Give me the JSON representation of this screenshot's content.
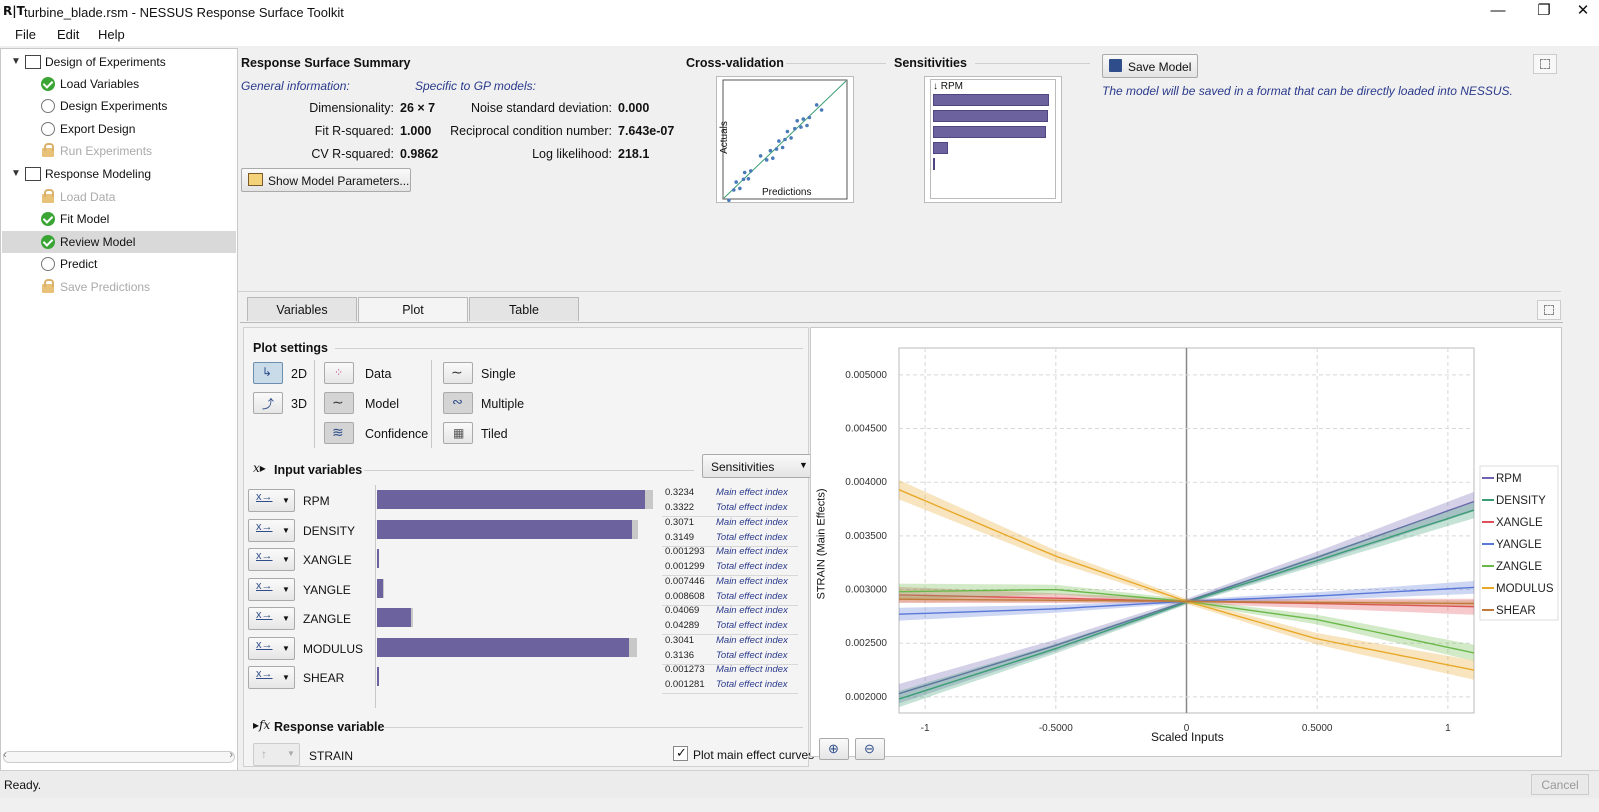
{
  "window": {
    "logo": "R|T",
    "title": "turbine_blade.rsm - NESSUS Response Surface Toolkit",
    "minimize": "—",
    "maximize": "❐",
    "close": "✕"
  },
  "menu": [
    "File",
    "Edit",
    "Help"
  ],
  "sidebar": {
    "items": [
      {
        "label": "Design of Experiments",
        "state": "group"
      },
      {
        "label": "Load Variables",
        "state": "done"
      },
      {
        "label": "Design Experiments",
        "state": "pending"
      },
      {
        "label": "Export Design",
        "state": "pending"
      },
      {
        "label": "Run Experiments",
        "state": "locked"
      },
      {
        "label": "Response Modeling",
        "state": "group"
      },
      {
        "label": "Load Data",
        "state": "locked"
      },
      {
        "label": "Fit Model",
        "state": "done"
      },
      {
        "label": "Review Model",
        "state": "done",
        "selected": true
      },
      {
        "label": "Predict",
        "state": "pending"
      },
      {
        "label": "Save Predictions",
        "state": "locked"
      }
    ]
  },
  "summary": {
    "title": "Response Surface Summary",
    "general_label": "General information:",
    "gp_label": "Specific to GP models:",
    "general": [
      {
        "label": "Dimensionality:",
        "value": "26 × 7"
      },
      {
        "label": "Fit R-squared:",
        "value": "1.000"
      },
      {
        "label": "CV R-squared:",
        "value": "0.9862"
      }
    ],
    "gp": [
      {
        "label": "Noise standard deviation:",
        "value": "0.000"
      },
      {
        "label": "Reciprocal condition number:",
        "value": "7.643e-07"
      },
      {
        "label": "Log likelihood:",
        "value": "218.1"
      }
    ],
    "show_params_button": "Show Model Parameters..."
  },
  "crossval": {
    "title": "Cross-validation",
    "xlabel": "Predictions",
    "ylabel": "Actuals"
  },
  "sensitivities": {
    "title": "Sensitivities",
    "header": "↓ RPM",
    "bars": [
      0.98,
      0.97,
      0.96,
      0.13,
      0.02
    ]
  },
  "save": {
    "button": "Save Model",
    "note": "The model will be saved in a format that can be directly loaded into NESSUS."
  },
  "tabs": [
    "Variables",
    "Plot",
    "Table"
  ],
  "active_tab": "Plot",
  "plot_settings": {
    "title": "Plot settings",
    "dims": [
      "2D",
      "3D"
    ],
    "layers": [
      "Data",
      "Model",
      "Confidence"
    ],
    "modes": [
      "Single",
      "Multiple",
      "Tiled"
    ]
  },
  "input_section": {
    "title": "Input variables",
    "sort_value": "Sensitivities",
    "main_label": "Main effect index",
    "total_label": "Total effect index"
  },
  "variables": [
    {
      "name": "RPM",
      "main": "0.3234",
      "total": "0.3322",
      "main_frac": 0.3234,
      "total_frac": 0.3322
    },
    {
      "name": "DENSITY",
      "main": "0.3071",
      "total": "0.3149",
      "main_frac": 0.3071,
      "total_frac": 0.3149
    },
    {
      "name": "XANGLE",
      "main": "0.001293",
      "total": "0.001299",
      "main_frac": 0.001293,
      "total_frac": 0.001299
    },
    {
      "name": "YANGLE",
      "main": "0.007446",
      "total": "0.008608",
      "main_frac": 0.007446,
      "total_frac": 0.008608
    },
    {
      "name": "ZANGLE",
      "main": "0.04069",
      "total": "0.04289",
      "main_frac": 0.04069,
      "total_frac": 0.04289
    },
    {
      "name": "MODULUS",
      "main": "0.3041",
      "total": "0.3136",
      "main_frac": 0.3041,
      "total_frac": 0.3136
    },
    {
      "name": "SHEAR",
      "main": "0.001273",
      "total": "0.001281",
      "main_frac": 0.001273,
      "total_frac": 0.001281
    }
  ],
  "response": {
    "title": "Response variable",
    "name": "STRAIN",
    "checkbox_label": "Plot main effect curves",
    "checked": true
  },
  "chart_data": {
    "type": "line",
    "xlabel": "Scaled Inputs",
    "ylabel": "STRAIN (Main Effects)",
    "xlim": [
      -1.1,
      1.1
    ],
    "ylim": [
      0.00185,
      0.00525
    ],
    "xticks": [
      -1,
      -0.5,
      0,
      0.5,
      1
    ],
    "xtick_labels": [
      "-1",
      "-0.5000",
      "0",
      "0.5000",
      "1"
    ],
    "yticks": [
      0.002,
      0.0025,
      0.003,
      0.0035,
      0.004,
      0.0045,
      0.005
    ],
    "ytick_labels": [
      "0.002000",
      "0.002500",
      "0.003000",
      "0.003500",
      "0.004000",
      "0.004500",
      "0.005000"
    ],
    "grid": true,
    "legend": "right",
    "series": [
      {
        "name": "RPM",
        "color": "#6e64b0",
        "x": [
          -1.1,
          -0.5,
          0,
          0.5,
          1.1
        ],
        "y": [
          0.00203,
          0.00248,
          0.00289,
          0.0033,
          0.00382
        ],
        "band": 6e-05
      },
      {
        "name": "DENSITY",
        "color": "#3a9e74",
        "x": [
          -1.1,
          -0.5,
          0,
          0.5,
          1.1
        ],
        "y": [
          0.00198,
          0.00245,
          0.00288,
          0.00327,
          0.00374
        ],
        "band": 5e-05
      },
      {
        "name": "XANGLE",
        "color": "#e0505a",
        "x": [
          -1.1,
          -0.5,
          0,
          0.5,
          1.1
        ],
        "y": [
          0.00295,
          0.00292,
          0.00289,
          0.00287,
          0.00284
        ],
        "band": 5e-05
      },
      {
        "name": "YANGLE",
        "color": "#5a78d8",
        "x": [
          -1.1,
          -0.5,
          0,
          0.5,
          1.1
        ],
        "y": [
          0.00277,
          0.00282,
          0.00289,
          0.00294,
          0.00302
        ],
        "band": 4e-05
      },
      {
        "name": "ZANGLE",
        "color": "#6bb84a",
        "x": [
          -1.1,
          -0.5,
          0,
          0.5,
          1.1
        ],
        "y": [
          0.00298,
          0.003,
          0.00289,
          0.00272,
          0.00241
        ],
        "band": 5e-05
      },
      {
        "name": "MODULUS",
        "color": "#e8a92a",
        "x": [
          -1.1,
          -0.5,
          0,
          0.5,
          1.1
        ],
        "y": [
          0.00393,
          0.00331,
          0.00289,
          0.00254,
          0.00225
        ],
        "band": 6e-05
      },
      {
        "name": "SHEAR",
        "color": "#c07a3a",
        "x": [
          -1.1,
          -0.5,
          0,
          0.5,
          1.1
        ],
        "y": [
          0.00291,
          0.0029,
          0.00289,
          0.00288,
          0.00287
        ],
        "band": 2e-05
      }
    ]
  },
  "status": {
    "text": "Ready.",
    "cancel": "Cancel"
  }
}
